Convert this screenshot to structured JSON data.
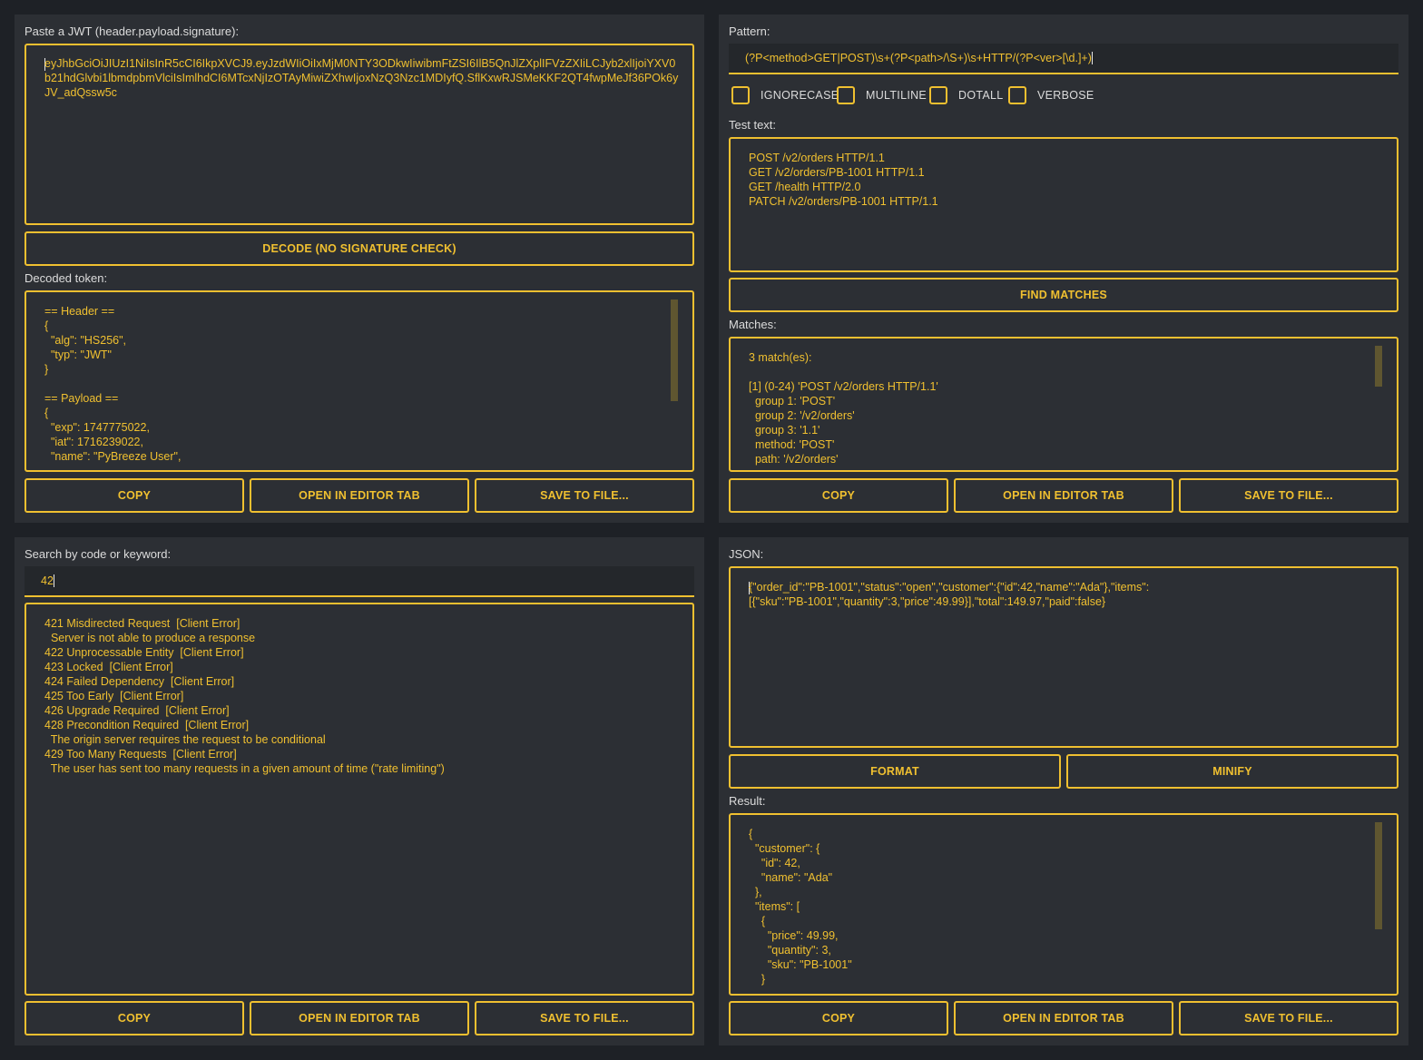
{
  "jwt": {
    "input_label": "Paste a JWT (header.payload.signature):",
    "token": "eyJhbGciOiJIUzI1NiIsInR5cCI6IkpXVCJ9.eyJzdWIiOiIxMjM0NTY3ODkwIiwibmFtZSI6IlB5QnJlZXplIFVzZXIiLCJyb2xlIjoiYXV0b21hdGlvbi1lbmdpbmVlciIsImlhdCI6MTcxNjIzOTAyMiwiZXhwIjoxNzQ3Nzc1MDIyfQ.SflKxwRJSMeKKF2QT4fwpMeJf36POk6yJV_adQssw5c",
    "decode_button": "DECODE (NO SIGNATURE CHECK)",
    "output_label": "Decoded token:",
    "output_lines": [
      "== Header ==",
      "{",
      "  \"alg\": \"HS256\",",
      "  \"typ\": \"JWT\"",
      "}",
      "",
      "== Payload ==",
      "{",
      "  \"exp\": 1747775022,",
      "  \"iat\": 1716239022,",
      "  \"name\": \"PyBreeze User\","
    ],
    "copy": "COPY",
    "open_tab": "OPEN IN EDITOR TAB",
    "save": "SAVE TO FILE..."
  },
  "regex": {
    "pattern_label": "Pattern:",
    "pattern": "(?P<method>GET|POST)\\s+(?P<path>/\\S+)\\s+HTTP/(?P<ver>[\\d.]+)",
    "flags": [
      "IGNORECASE",
      "MULTILINE",
      "DOTALL",
      "VERBOSE"
    ],
    "test_label": "Test text:",
    "test_lines": [
      "POST /v2/orders HTTP/1.1",
      "GET /v2/orders/PB-1001 HTTP/1.1",
      "GET /health HTTP/2.0",
      "PATCH /v2/orders/PB-1001 HTTP/1.1"
    ],
    "find_button": "FIND MATCHES",
    "matches_label": "Matches:",
    "match_lines": [
      "3 match(es):",
      "",
      "[1] (0-24) 'POST /v2/orders HTTP/1.1'",
      "  group 1: 'POST'",
      "  group 2: '/v2/orders'",
      "  group 3: '1.1'",
      "  method: 'POST'",
      "  path: '/v2/orders'"
    ],
    "copy": "COPY",
    "open_tab": "OPEN IN EDITOR TAB",
    "save": "SAVE TO FILE..."
  },
  "http": {
    "search_label": "Search by code or keyword:",
    "search_value": "42",
    "result_lines": [
      "421 Misdirected Request  [Client Error]",
      "  Server is not able to produce a response",
      "422 Unprocessable Entity  [Client Error]",
      "423 Locked  [Client Error]",
      "424 Failed Dependency  [Client Error]",
      "425 Too Early  [Client Error]",
      "426 Upgrade Required  [Client Error]",
      "428 Precondition Required  [Client Error]",
      "  The origin server requires the request to be conditional",
      "429 Too Many Requests  [Client Error]",
      "  The user has sent too many requests in a given amount of time (\"rate limiting\")"
    ],
    "copy": "COPY",
    "open_tab": "OPEN IN EDITOR TAB",
    "save": "SAVE TO FILE..."
  },
  "json_tool": {
    "input_label": "JSON:",
    "input_text": "{\"order_id\":\"PB-1001\",\"status\":\"open\",\"customer\":{\"id\":42,\"name\":\"Ada\"},\"items\":\n[{\"sku\":\"PB-1001\",\"quantity\":3,\"price\":49.99}],\"total\":149.97,\"paid\":false}",
    "format_button": "FORMAT",
    "minify_button": "MINIFY",
    "result_label": "Result:",
    "result_lines": [
      "{",
      "  \"customer\": {",
      "    \"id\": 42,",
      "    \"name\": \"Ada\"",
      "  },",
      "  \"items\": [",
      "    {",
      "      \"price\": 49.99,",
      "      \"quantity\": 3,",
      "      \"sku\": \"PB-1001\"",
      "    }"
    ],
    "copy": "COPY",
    "open_tab": "OPEN IN EDITOR TAB",
    "save": "SAVE TO FILE..."
  },
  "colors": {
    "accent": "#f0c030",
    "panel": "#2c2f34",
    "background": "#1e2126",
    "label": "#dcdcdc"
  }
}
